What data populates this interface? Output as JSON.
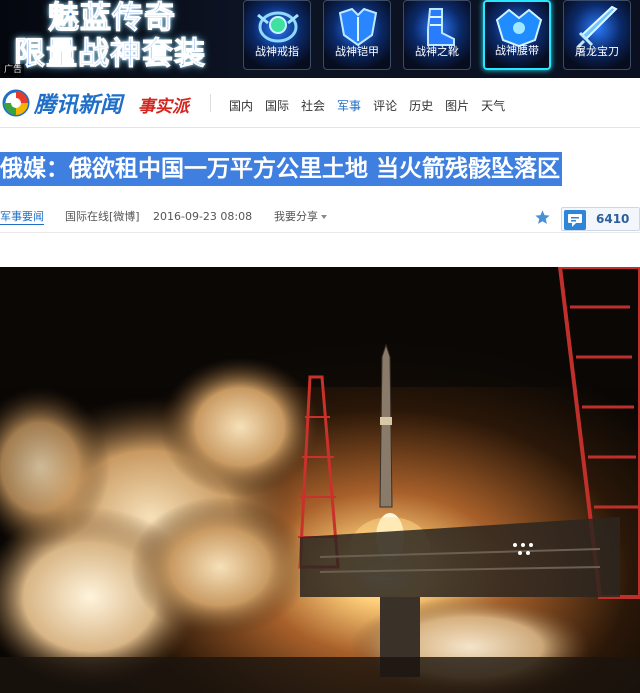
{
  "ad": {
    "title_line1": "魅蓝传奇",
    "title_line2": "限量战神套装",
    "tag": "广告",
    "items": [
      {
        "label": "战神戒指",
        "icon": "ring-icon"
      },
      {
        "label": "战神铠甲",
        "icon": "armor-icon"
      },
      {
        "label": "战神之靴",
        "icon": "boots-icon"
      },
      {
        "label": "战神腰带",
        "icon": "belt-icon",
        "active": true
      },
      {
        "label": "屠龙宝刀",
        "icon": "sword-icon"
      }
    ]
  },
  "nav": {
    "logo_text": "腾讯新闻",
    "logo_sub": "事实派",
    "links": [
      "国内",
      "国际",
      "社会",
      "军事",
      "评论",
      "历史",
      "图片",
      "天气"
    ],
    "active_link": "军事"
  },
  "article": {
    "headline": "俄媒：俄欲租中国一万平方公里土地 当火箭残骸坠落区",
    "category": "军事要闻",
    "source": "国际在线[微博]",
    "time": "2016-09-23  08:08",
    "share_label": "我要分享",
    "comment_count": "6410"
  },
  "colors": {
    "brand_blue": "#1f6fc8",
    "headline_bg": "#3f7fe0",
    "ad_accent": "#27e6ff"
  }
}
